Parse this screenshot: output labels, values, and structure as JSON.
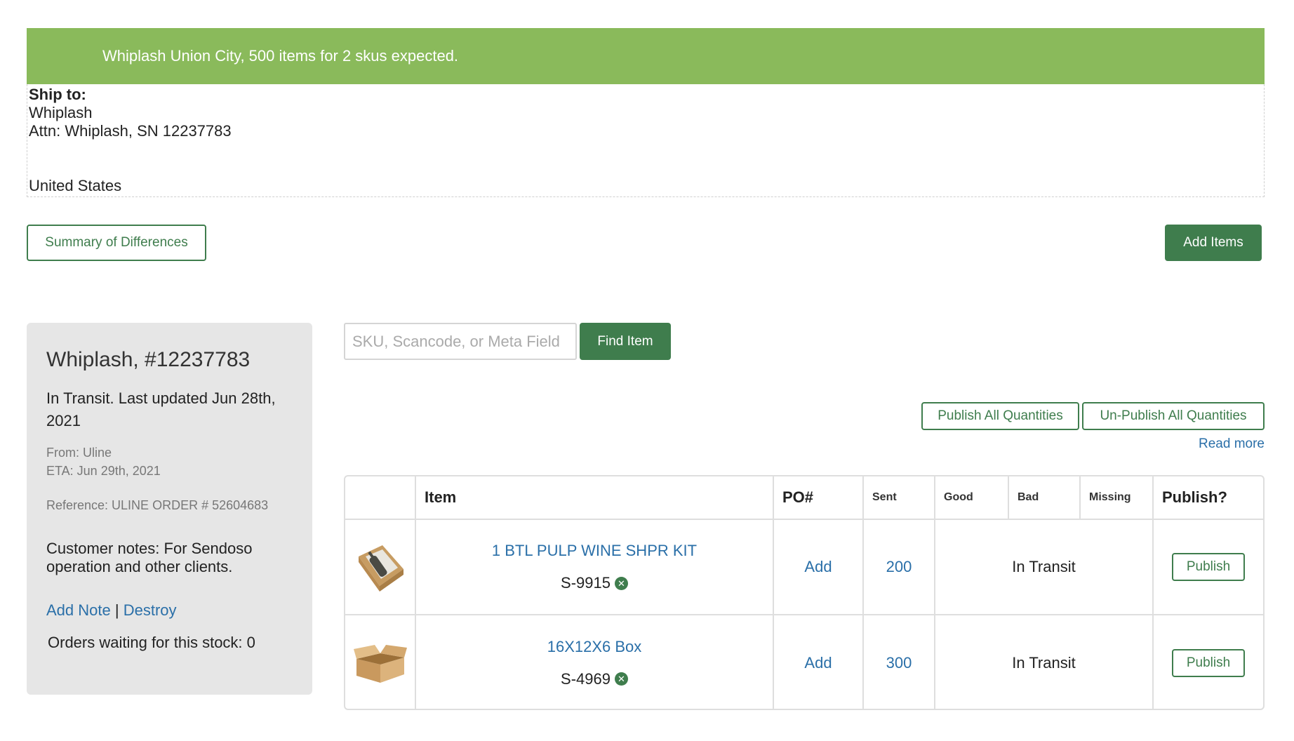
{
  "banner": {
    "text": "Whiplash Union City, 500 items for 2 skus expected."
  },
  "ship_to": {
    "label": "Ship to:",
    "name": "Whiplash",
    "attn": "Attn: Whiplash, SN 12237783",
    "country": "United States"
  },
  "actions": {
    "summary_label": "Summary of Differences",
    "add_items_label": "Add Items"
  },
  "sidebar": {
    "title": "Whiplash, #12237783",
    "status": "In Transit. Last updated Jun 28th, 2021",
    "from": "From: Uline",
    "eta": "ETA: Jun 29th, 2021",
    "reference": "Reference: ULINE ORDER # 52604683",
    "notes": "Customer notes: For Sendoso operation and other clients.",
    "add_note": "Add Note",
    "separator": "|",
    "destroy": "Destroy",
    "orders_waiting": "Orders waiting for this stock: 0"
  },
  "search": {
    "placeholder": "SKU, Scancode, or Meta Field",
    "button": "Find Item"
  },
  "publish_controls": {
    "publish_all": "Publish All Quantities",
    "unpublish_all": "Un-Publish All Quantities",
    "read_more": "Read more"
  },
  "table": {
    "headers": {
      "item": "Item",
      "po": "PO#",
      "sent": "Sent",
      "good": "Good",
      "bad": "Bad",
      "missing": "Missing",
      "publish": "Publish?"
    },
    "rows": [
      {
        "image": "wine-kit-image",
        "name": "1 BTL PULP WINE SHPR KIT",
        "sku": "S-9915",
        "po": "Add",
        "sent": "200",
        "status": "In Transit",
        "publish": "Publish"
      },
      {
        "image": "cardboard-box-image",
        "name": "16X12X6 Box",
        "sku": "S-4969",
        "po": "Add",
        "sent": "300",
        "status": "In Transit",
        "publish": "Publish"
      }
    ]
  },
  "colors": {
    "banner": "#8aba5b",
    "primary_green": "#3f7d4d",
    "link_blue": "#2a6fa8",
    "sidebar_bg": "#e6e6e6"
  }
}
